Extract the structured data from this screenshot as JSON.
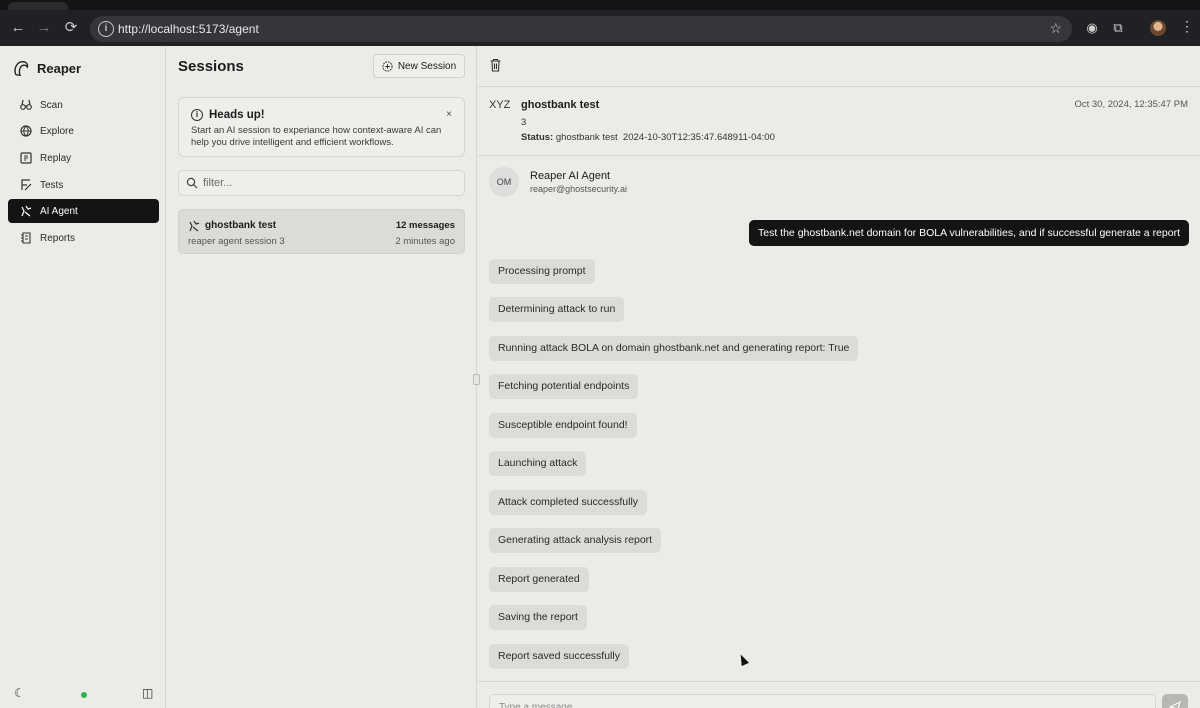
{
  "browser": {
    "url": "http://localhost:5173/agent"
  },
  "sidebar": {
    "brand": "Reaper",
    "items": [
      {
        "label": "Scan",
        "icon": "binoculars-icon"
      },
      {
        "label": "Explore",
        "icon": "globe-icon"
      },
      {
        "label": "Replay",
        "icon": "replay-icon"
      },
      {
        "label": "Tests",
        "icon": "tests-icon"
      },
      {
        "label": "AI Agent",
        "icon": "agent-icon",
        "active": true
      },
      {
        "label": "Reports",
        "icon": "reports-icon"
      }
    ]
  },
  "sessions": {
    "title": "Sessions",
    "new_session_label": "New Session",
    "notice": {
      "title": "Heads up!",
      "body": "Start an AI session to experiance how context-aware AI can help you drive intelligent and efficient workflows.",
      "close": "×"
    },
    "filter_placeholder": "filter...",
    "list": [
      {
        "name": "ghostbank test",
        "description": "reaper agent session 3",
        "count": "12 messages",
        "time": "2 minutes ago"
      }
    ]
  },
  "chat": {
    "header": {
      "prefix": "XYZ",
      "title": "ghostbank test",
      "number": "3",
      "status_label": "Status:",
      "status_value": "ghostbank test",
      "status_timestamp": "2024-10-30T12:35:47.648911-04:00",
      "date": "Oct 30, 2024, 12:35:47 PM"
    },
    "agent": {
      "initials": "OM",
      "name": "Reaper AI Agent",
      "email": "reaper@ghostsecurity.ai"
    },
    "user_message": "Test the ghostbank.net domain for BOLA vulnerabilities, and if successful generate a report",
    "bot_messages": [
      "Processing prompt",
      "Determining attack to run",
      "Running attack BOLA on domain ghostbank.net and generating report: True",
      "Fetching potential endpoints",
      "Susceptible endpoint found!",
      "Launching attack",
      "Attack completed successfully",
      "Generating attack analysis report",
      "Report generated",
      "Saving the report",
      "Report saved successfully"
    ],
    "composer_placeholder": "Type a message..."
  }
}
